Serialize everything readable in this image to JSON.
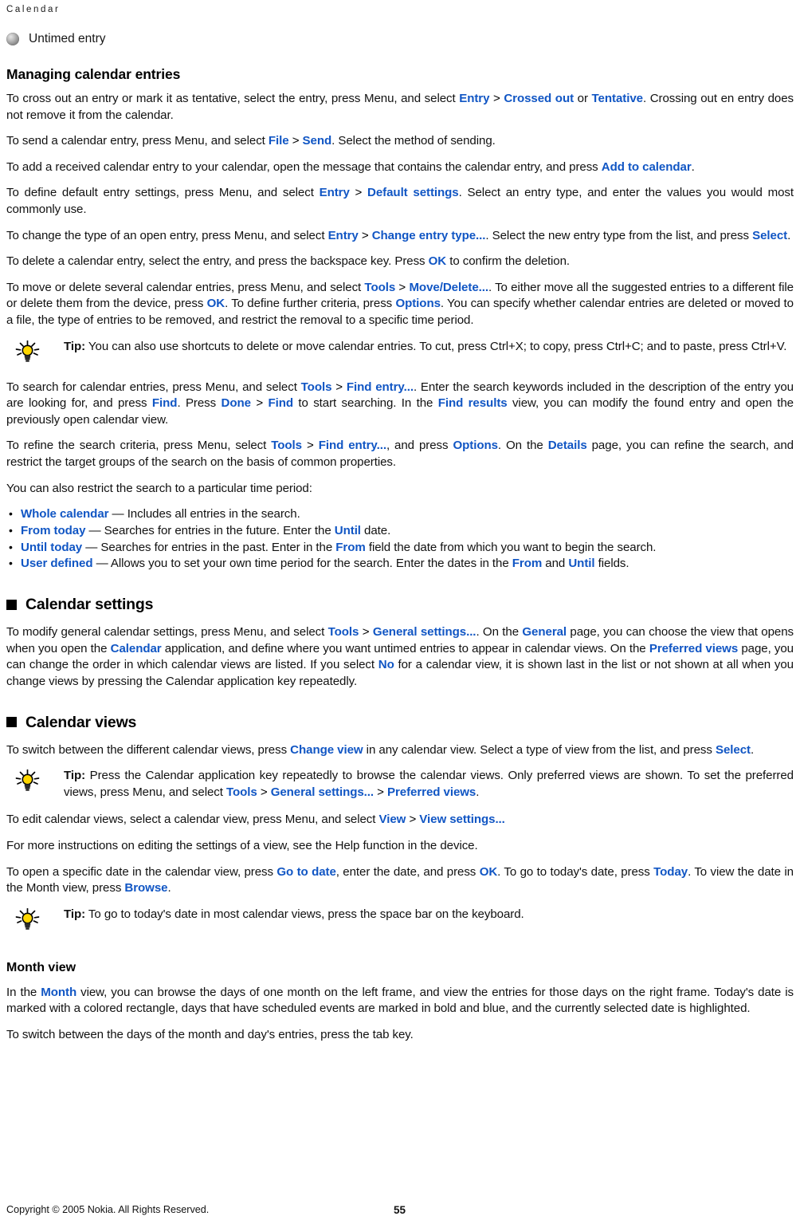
{
  "header": {
    "running_title": "Calendar"
  },
  "legend": {
    "icon": "gray-ball-icon",
    "label": "Untimed entry"
  },
  "sections": {
    "managing": {
      "heading": "Managing calendar entries",
      "p1_a": "To cross out an entry or mark it as tentative, select the entry, press Menu, and select ",
      "p1_l1": "Entry",
      "p1_gt": " > ",
      "p1_l2": "Crossed out",
      "p1_b": " or ",
      "p1_l3": "Tentative",
      "p1_c": ". Crossing out en entry does not remove it from the calendar.",
      "p2_a": "To send a calendar entry, press Menu, and select ",
      "p2_l1": "File",
      "p2_gt": " > ",
      "p2_l2": "Send",
      "p2_b": ". Select the method of sending.",
      "p3_a": "To add a received calendar entry to your calendar, open the message that contains the calendar entry, and press ",
      "p3_l1": "Add to calendar",
      "p3_b": ".",
      "p4_a": "To define default entry settings, press Menu, and select ",
      "p4_l1": "Entry",
      "p4_gt": " > ",
      "p4_l2": "Default settings",
      "p4_b": ". Select an entry type, and enter the values you would most commonly use.",
      "p5_a": "To change the type of an open entry, press Menu, and select ",
      "p5_l1": "Entry",
      "p5_gt": " > ",
      "p5_l2": "Change entry type...",
      "p5_b": ". Select the new entry type from the list, and press ",
      "p5_l3": "Select",
      "p5_c": ".",
      "p6_a": "To delete a calendar entry, select the entry, and press the backspace key. Press ",
      "p6_l1": "OK",
      "p6_b": " to confirm the deletion.",
      "p7_a": "To move or delete several calendar entries, press Menu, and select ",
      "p7_l1": "Tools",
      "p7_gt": " > ",
      "p7_l2": "Move/Delete...",
      "p7_b": ". To either move all the suggested entries to a different file or delete them from the device, press ",
      "p7_l3": "OK",
      "p7_c": ". To define further criteria, press ",
      "p7_l4": "Options",
      "p7_d": ". You can specify whether calendar entries are deleted or moved to a file, the type of entries to be removed, and restrict the removal to a specific time period.",
      "tip1_word": "Tip:",
      "tip1_text": "  You can also use shortcuts to delete or move calendar entries. To cut, press Ctrl+X; to copy, press Ctrl+C; and to paste, press Ctrl+V.",
      "p8_a": "To search for calendar entries, press Menu, and select ",
      "p8_l1": "Tools",
      "p8_gt": " > ",
      "p8_l2": "Find entry...",
      "p8_b": ". Enter the search keywords included in the description of the entry you are looking for, and press ",
      "p8_l3": "Find",
      "p8_c": ". Press ",
      "p8_l4": "Done",
      "p8_gt2": " > ",
      "p8_l5": "Find",
      "p8_d": " to start searching. In the ",
      "p8_l6": "Find results",
      "p8_e": " view, you can modify the found entry and open the previously open calendar view.",
      "p9_a": "To refine the search criteria, press Menu, select ",
      "p9_l1": "Tools",
      "p9_gt": " > ",
      "p9_l2": "Find entry...",
      "p9_b": ", and press ",
      "p9_l3": "Options",
      "p9_c": ". On the ",
      "p9_l4": "Details",
      "p9_d": " page, you can refine the search, and restrict the target groups of the search on the basis of common properties.",
      "p10": "You can also restrict the search to a particular time period:",
      "list": [
        {
          "term": "Whole calendar",
          "dash": " — ",
          "desc": "Includes all entries in the search."
        },
        {
          "term": "From today",
          "dash": " — ",
          "desc_a": "Searches for entries in the future. Enter the ",
          "term2": "Until",
          "desc_b": " date."
        },
        {
          "term": "Until today",
          "dash": " — ",
          "desc_a": "Searches for entries in the past. Enter in the ",
          "term2": "From",
          "desc_b": " field the date from which you want to begin the search."
        },
        {
          "term": "User defined",
          "dash": " — ",
          "desc_a": "Allows you to set your own time period for the search. Enter the dates in the ",
          "term2": "From",
          "desc_b": " and ",
          "term3": "Until",
          "desc_c": " fields."
        }
      ]
    },
    "calendar_settings": {
      "heading": "Calendar settings",
      "p1_a": "To modify general calendar settings, press Menu, and select ",
      "p1_l1": "Tools",
      "p1_gt": " > ",
      "p1_l2": "General settings...",
      "p1_b": ". On the ",
      "p1_l3": "General",
      "p1_c": " page, you can choose the view that opens when you open the ",
      "p1_l4": "Calendar",
      "p1_d": " application, and define where you want untimed entries to appear in calendar views. On the ",
      "p1_l5": "Preferred views",
      "p1_e": " page, you can change the order in which calendar views are listed. If you select ",
      "p1_l6": "No",
      "p1_f": " for a calendar view, it is shown last in the list or not shown at all when you change views by pressing the Calendar application key repeatedly."
    },
    "calendar_views": {
      "heading": "Calendar views",
      "p1_a": "To switch between the different calendar views, press ",
      "p1_l1": "Change view",
      "p1_b": " in any calendar view. Select a type of view from the list, and press ",
      "p1_l2": "Select",
      "p1_c": ".",
      "tip1_word": "Tip:",
      "tip1_a": "  Press the Calendar application key repeatedly to browse the calendar views. Only preferred views are shown. To set the preferred views, press Menu, and select ",
      "tip1_l1": "Tools",
      "tip1_gt": " > ",
      "tip1_l2": "General settings...",
      "tip1_gt2": " > ",
      "tip1_l3": "Preferred views",
      "tip1_b": ".",
      "p2_a": "To edit calendar views, select a calendar view, press Menu, and select ",
      "p2_l1": "View",
      "p2_gt": " > ",
      "p2_l2": "View settings...",
      "p2_b": "",
      "p3": "For more instructions on editing the settings of a view, see the Help function in the device.",
      "p4_a": "To open a specific date in the calendar view, press ",
      "p4_l1": "Go to date",
      "p4_b": ", enter the date, and press ",
      "p4_l2": "OK",
      "p4_c": ". To go to today's date, press ",
      "p4_l3": "Today",
      "p4_d": ". To view the date in the Month view, press ",
      "p4_l4": "Browse",
      "p4_e": ".",
      "tip2_word": "Tip:",
      "tip2_text": " To go to today's date in most calendar views, press the space bar on the keyboard."
    },
    "month_view": {
      "heading": "Month view",
      "p1_a": "In the ",
      "p1_l1": "Month",
      "p1_b": " view, you can browse the days of one month on the left frame, and view the entries for those days on the right frame. Today's date is marked with a colored rectangle, days that have scheduled events are marked in bold and blue, and the currently selected date is highlighted.",
      "p2": "To switch between the days of the month and day's entries, press the tab key."
    }
  },
  "footer": {
    "copyright": "Copyright © 2005 Nokia. All Rights Reserved.",
    "page_number": "55"
  },
  "colors": {
    "link": "#1156c4",
    "text": "#111111",
    "tip_bulb": "#ffd700"
  }
}
